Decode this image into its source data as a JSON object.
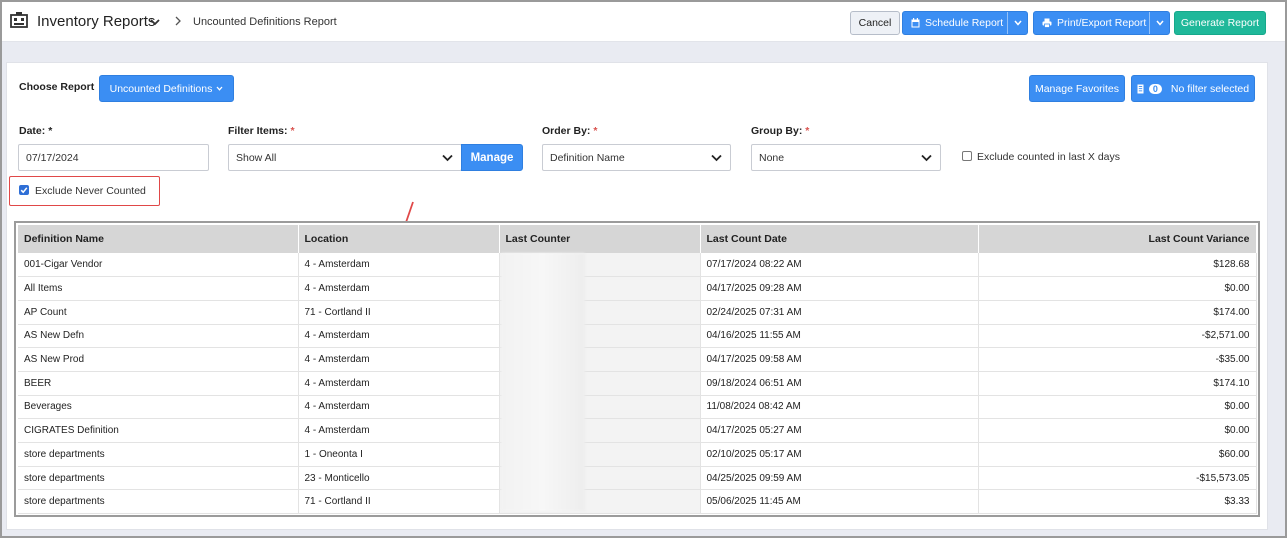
{
  "header": {
    "app_title": "Inventory Reports",
    "breadcrumb": "Uncounted Definitions Report",
    "cancel_label": "Cancel",
    "schedule_label": "Schedule Report",
    "print_label": "Print/Export Report",
    "generate_label": "Generate Report"
  },
  "report": {
    "choose_label": "Choose Report",
    "selected_report": "Uncounted Definitions",
    "manage_favorites_label": "Manage Favorites",
    "filter_count": "0",
    "filter_status": "No filter selected"
  },
  "filters": {
    "date_label": "Date:",
    "date_required": "*",
    "date_value": "07/17/2024",
    "filter_items_label": "Filter Items:",
    "filter_items_required": "*",
    "filter_items_value": "Show All",
    "manage_label": "Manage",
    "order_by_label": "Order By:",
    "order_by_required": "*",
    "order_by_value": "Definition Name",
    "group_by_label": "Group By:",
    "group_by_required": "*",
    "group_by_value": "None",
    "exclude_counted_label": "Exclude counted in last X days",
    "exclude_counted_checked": false,
    "exclude_never_label": "Exclude Never Counted",
    "exclude_never_checked": true
  },
  "table": {
    "columns": [
      "Definition Name",
      "Location",
      "Last Counter",
      "Last Count Date",
      "Last Count Variance"
    ],
    "rows": [
      {
        "name": "001-Cigar Vendor",
        "location": "4 - Amsterdam",
        "counter": "",
        "date": "07/17/2024 08:22 AM",
        "variance": "$128.68"
      },
      {
        "name": "All Items",
        "location": "4 - Amsterdam",
        "counter": "",
        "date": "04/17/2025 09:28 AM",
        "variance": "$0.00"
      },
      {
        "name": "AP Count",
        "location": "71 - Cortland II",
        "counter": "",
        "date": "02/24/2025 07:31 AM",
        "variance": "$174.00"
      },
      {
        "name": "AS New Defn",
        "location": "4 - Amsterdam",
        "counter": "",
        "date": "04/16/2025 11:55 AM",
        "variance": "-$2,571.00"
      },
      {
        "name": "AS New Prod",
        "location": "4 - Amsterdam",
        "counter": "",
        "date": "04/17/2025 09:58 AM",
        "variance": "-$35.00"
      },
      {
        "name": "BEER",
        "location": "4 - Amsterdam",
        "counter": "",
        "date": "09/18/2024 06:51 AM",
        "variance": "$174.10"
      },
      {
        "name": "Beverages",
        "location": "4 - Amsterdam",
        "counter": "",
        "date": "11/08/2024 08:42 AM",
        "variance": "$0.00"
      },
      {
        "name": "CIGRATES Definition",
        "location": "4 - Amsterdam",
        "counter": "",
        "date": "04/17/2025 05:27 AM",
        "variance": "$0.00"
      },
      {
        "name": "store departments",
        "location": "1 - Oneonta I",
        "counter": "",
        "date": "02/10/2025 05:17 AM",
        "variance": "$60.00"
      },
      {
        "name": "store departments",
        "location": "23 - Monticello",
        "counter": "",
        "date": "04/25/2025 09:59 AM",
        "variance": "-$15,573.05"
      },
      {
        "name": "store departments",
        "location": "71 - Cortland II",
        "counter": "",
        "date": "05/06/2025 11:45 AM",
        "variance": "$3.33"
      }
    ]
  },
  "colors": {
    "primary": "#3b8ef3",
    "success": "#1fb89a",
    "highlight": "#e04848"
  }
}
